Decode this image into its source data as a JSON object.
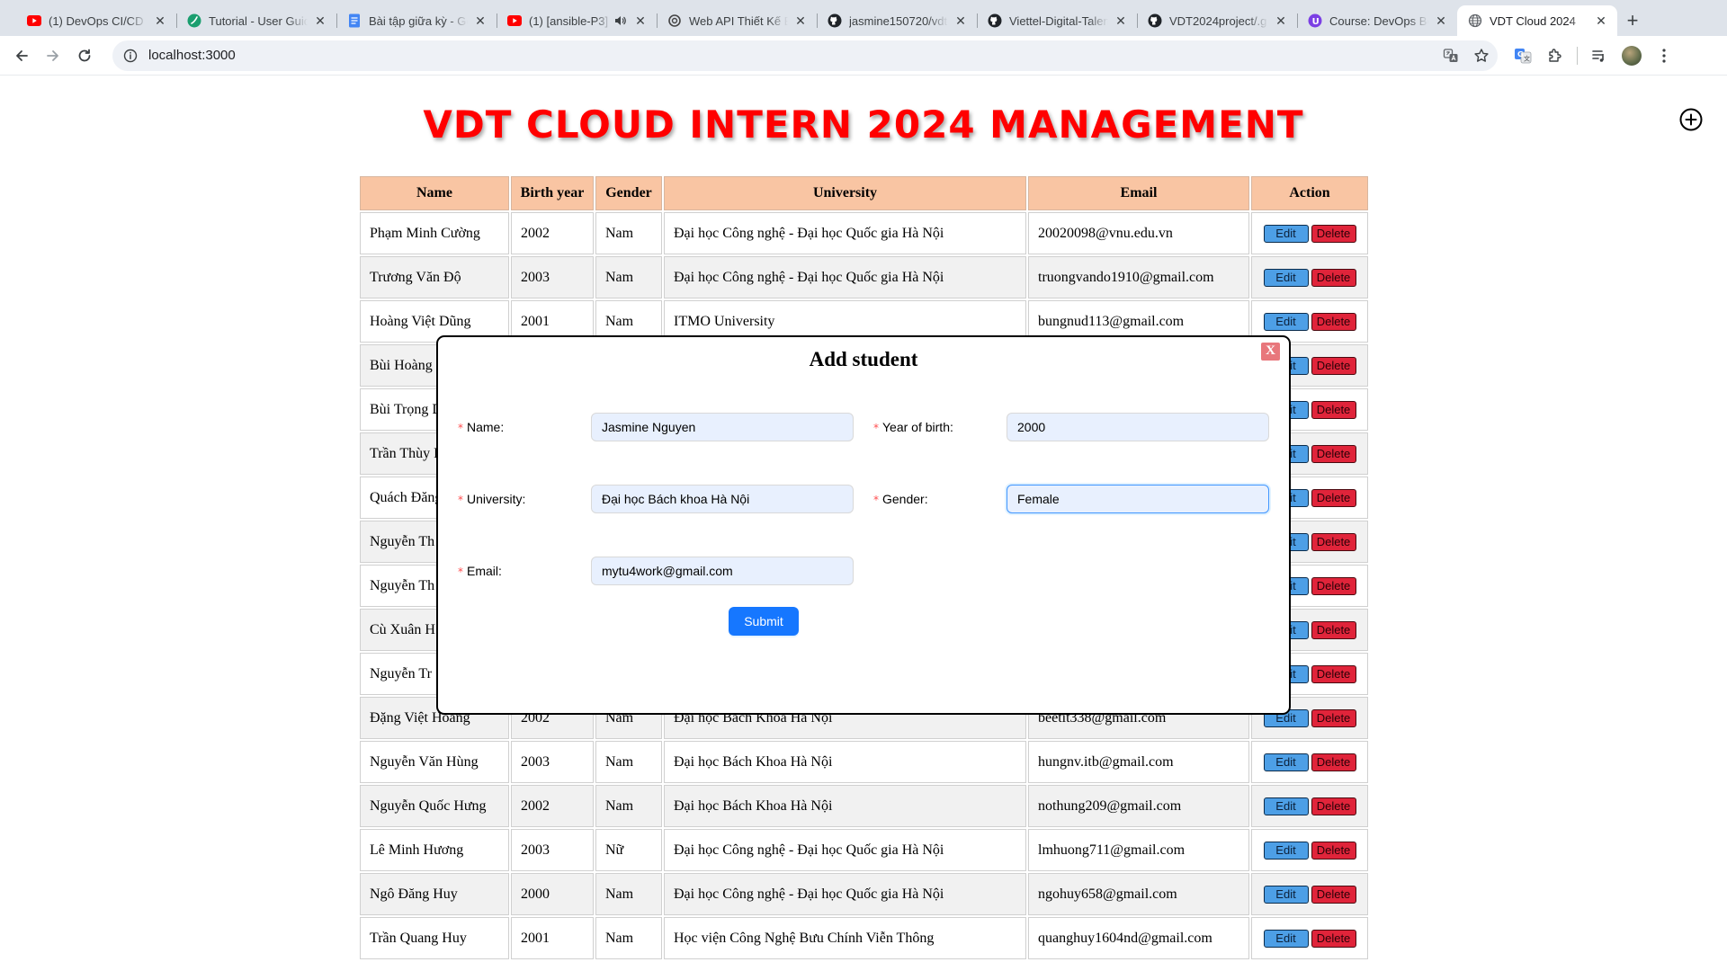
{
  "browser": {
    "tabs": [
      {
        "title": "(1) DevOps CI/CD E",
        "icon": "youtube-icon"
      },
      {
        "title": "Tutorial - User Guid",
        "icon": "tutorial-icon"
      },
      {
        "title": "Bài tập giữa kỳ - Go",
        "icon": "docs-icon"
      },
      {
        "title": "(1) [ansible-P3]",
        "icon": "youtube-icon",
        "audio": true
      },
      {
        "title": "Web API Thiết Kế B",
        "icon": "openai-icon"
      },
      {
        "title": "jasmine150720/vdt",
        "icon": "github-icon"
      },
      {
        "title": "Viettel-Digital-Talen",
        "icon": "github-icon"
      },
      {
        "title": "VDT2024project/.g",
        "icon": "github-icon"
      },
      {
        "title": "Course: DevOps Bo",
        "icon": "course-icon"
      },
      {
        "title": "VDT Cloud 2024",
        "icon": "globe-icon",
        "active": true
      }
    ],
    "close_glyph": "✕",
    "new_tab_glyph": "+",
    "url": "localhost:3000"
  },
  "page": {
    "title": "VDT CLOUD INTERN 2024 MANAGEMENT"
  },
  "table": {
    "headers": [
      "Name",
      "Birth year",
      "Gender",
      "University",
      "Email",
      "Action"
    ],
    "edit_label": "Edit",
    "delete_label": "Delete",
    "rows": [
      [
        "Phạm Minh Cường",
        "2002",
        "Nam",
        "Đại học Công nghệ - Đại học Quốc gia Hà Nội",
        "20020098@vnu.edu.vn"
      ],
      [
        "Trương Văn Độ",
        "2003",
        "Nam",
        "Đại học Công nghệ - Đại học Quốc gia Hà Nội",
        "truongvando1910@gmail.com"
      ],
      [
        "Hoàng Việt Dũng",
        "2001",
        "Nam",
        "ITMO University",
        "bungnud113@gmail.com"
      ],
      [
        "Bùi Hoàng",
        "",
        "",
        "",
        ""
      ],
      [
        "Bùi Trọng D",
        "",
        "",
        "",
        ""
      ],
      [
        "Trần Thùy L",
        "",
        "",
        "",
        ""
      ],
      [
        "Quách Đăng",
        "",
        "",
        "",
        ""
      ],
      [
        "Nguyễn Th",
        "",
        "",
        "",
        ""
      ],
      [
        "Nguyễn Th",
        "",
        "",
        "",
        ""
      ],
      [
        "Cù Xuân H",
        "",
        "",
        "",
        ""
      ],
      [
        "Nguyễn Tr",
        "",
        "",
        "",
        ""
      ],
      [
        "Đặng Việt Hoàng",
        "2002",
        "Nam",
        "Đại học Bách Khoa Hà Nội",
        "beetit338@gmail.com"
      ],
      [
        "Nguyễn Văn Hùng",
        "2003",
        "Nam",
        "Đại học Bách Khoa Hà Nội",
        "hungnv.itb@gmail.com"
      ],
      [
        "Nguyễn Quốc Hưng",
        "2002",
        "Nam",
        "Đại học Bách Khoa Hà Nội",
        "nothung209@gmail.com"
      ],
      [
        "Lê Minh Hương",
        "2003",
        "Nữ",
        "Đại học Công nghệ - Đại học Quốc gia Hà Nội",
        "lmhuong711@gmail.com"
      ],
      [
        "Ngô Đăng Huy",
        "2000",
        "Nam",
        "Đại học Công nghệ - Đại học Quốc gia Hà Nội",
        "ngohuy658@gmail.com"
      ],
      [
        "Trần Quang Huy",
        "2001",
        "Nam",
        "Học viện Công Nghệ Bưu Chính Viễn Thông",
        "quanghuy1604nd@gmail.com"
      ]
    ]
  },
  "modal": {
    "title": "Add student",
    "close_label": "X",
    "required_mark": "*",
    "fields": {
      "name": {
        "label": "Name",
        "value": "Jasmine Nguyen"
      },
      "year": {
        "label": "Year of birth",
        "value": "2000"
      },
      "university": {
        "label": "University",
        "value": "Đại học Bách khoa Hà Nội"
      },
      "gender": {
        "label": "Gender",
        "value": "Female"
      },
      "email": {
        "label": "Email",
        "value": "mytu4work@gmail.com"
      }
    },
    "label_suffix": ":",
    "submit_label": "Submit"
  },
  "colors": {
    "title": "#ff0000",
    "header_bg": "#f9c5a3",
    "edit_button": "#4d9fe6",
    "delete_button": "#e0243a",
    "primary": "#1677ff"
  }
}
